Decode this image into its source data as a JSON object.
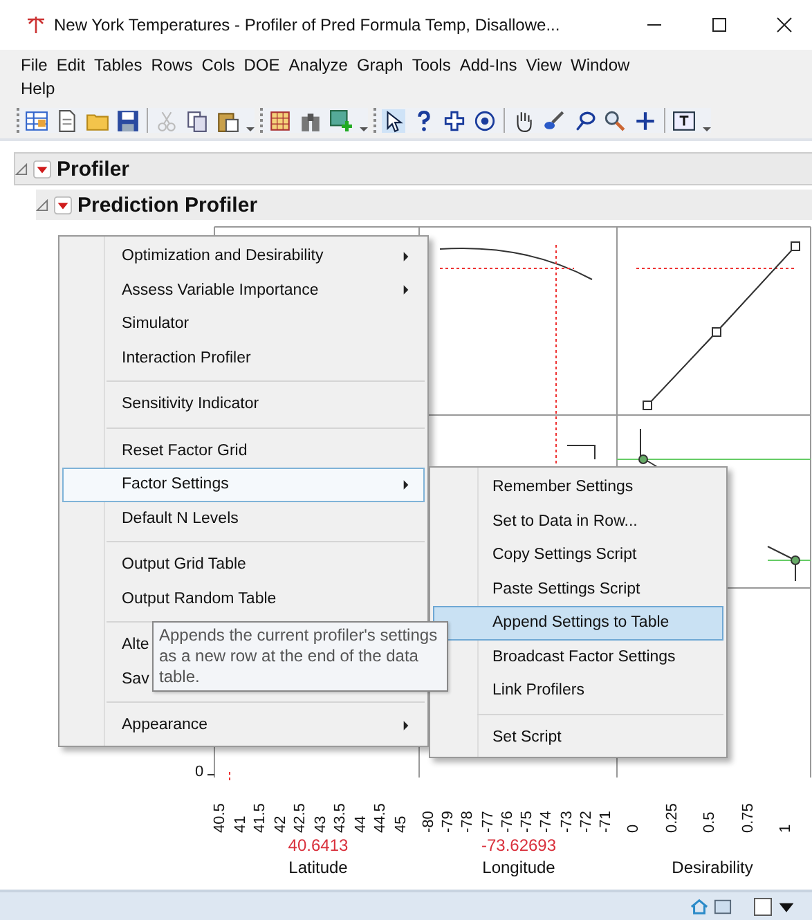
{
  "window": {
    "title": "New York Temperatures - Profiler of Pred Formula Temp, Disallowe..."
  },
  "menu_bar": [
    [
      "File",
      "Edit",
      "Tables",
      "Rows",
      "Cols",
      "DOE",
      "Analyze",
      "Graph",
      "Tools",
      "Add-Ins",
      "View",
      "Window"
    ],
    [
      "Help"
    ]
  ],
  "outline": [
    {
      "title": "Profiler",
      "expanded": true
    },
    {
      "title": "Prediction Profiler",
      "expanded": true
    }
  ],
  "profiler": {
    "y_ticks": [
      "0"
    ],
    "axes": [
      {
        "name": "Latitude",
        "value": "40.6413",
        "ticks": [
          "40.5",
          "41",
          "41.5",
          "42",
          "42.5",
          "43",
          "43.5",
          "44",
          "44.5",
          "45"
        ]
      },
      {
        "name": "Longitude",
        "value": "-73.62693",
        "ticks": [
          "-80",
          "-79",
          "-78",
          "-77",
          "-76",
          "-75",
          "-74",
          "-73",
          "-72",
          "-71"
        ]
      },
      {
        "name": "Desirability",
        "ticks": [
          "0",
          "0.25",
          "0.5",
          "0.75",
          "1"
        ]
      }
    ]
  },
  "context_menu": {
    "groups": [
      [
        {
          "label": "Optimization and Desirability",
          "submenu": true,
          "selected": false
        },
        {
          "label": "Assess Variable Importance",
          "submenu": true,
          "selected": false
        },
        {
          "label": "Simulator",
          "submenu": false,
          "selected": false
        },
        {
          "label": "Interaction Profiler",
          "submenu": false,
          "selected": false
        }
      ],
      [
        {
          "label": "Sensitivity Indicator",
          "submenu": false,
          "selected": false
        }
      ],
      [
        {
          "label": "Reset Factor Grid",
          "submenu": false,
          "selected": false
        },
        {
          "label": "Factor Settings",
          "submenu": true,
          "selected": true
        },
        {
          "label": "Default N Levels",
          "submenu": false,
          "selected": false
        }
      ],
      [
        {
          "label": "Output Grid Table",
          "submenu": false,
          "selected": false
        },
        {
          "label": "Output Random Table",
          "submenu": false,
          "selected": false
        }
      ],
      [
        {
          "label": "Alte",
          "selected": false
        },
        {
          "label": "Sav",
          "selected": false
        }
      ],
      [
        {
          "label": "Appearance",
          "submenu": true,
          "selected": false
        }
      ]
    ]
  },
  "submenu": {
    "groups": [
      [
        {
          "label": "Remember Settings",
          "selected": false
        },
        {
          "label": "Set to Data in Row...",
          "selected": false
        },
        {
          "label": "Copy Settings Script",
          "selected": false
        },
        {
          "label": "Paste Settings Script",
          "selected": false
        },
        {
          "label": "Append Settings to Table",
          "selected": true
        },
        {
          "label": "Broadcast Factor Settings",
          "selected": false
        },
        {
          "label": "Link Profilers",
          "selected": false
        }
      ],
      [
        {
          "label": "Set Script",
          "selected": false
        }
      ]
    ]
  },
  "tooltip": {
    "text": "Appends the current profiler's settings as a new row at the end of the data table."
  }
}
